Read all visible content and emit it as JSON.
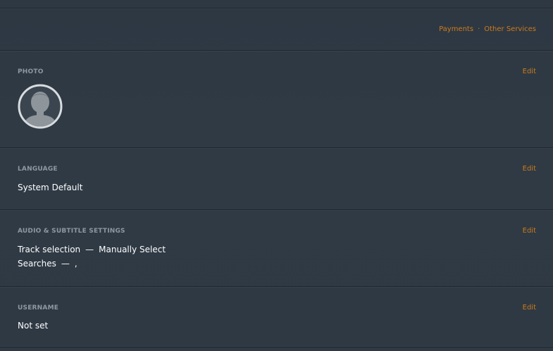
{
  "top_links": {
    "payments": "Payments",
    "separator": "·",
    "other_services": "Other Services"
  },
  "photo": {
    "label": "PHOTO",
    "edit": "Edit",
    "avatar_icon": "user-silhouette-icon"
  },
  "language": {
    "label": "LANGUAGE",
    "edit": "Edit",
    "value": "System Default"
  },
  "audio_subtitle": {
    "label": "AUDIO & SUBTITLE SETTINGS",
    "edit": "Edit",
    "track_label": "Track selection",
    "dash": "—",
    "track_value": "Manually Select",
    "searches_label": "Searches",
    "searches_value": ","
  },
  "username": {
    "label": "USERNAME",
    "edit": "Edit",
    "value": "Not set"
  },
  "colors": {
    "background": "#2f3a45",
    "accent": "#cc7b19",
    "label": "#8f98a1",
    "divider": "#1f2730"
  }
}
